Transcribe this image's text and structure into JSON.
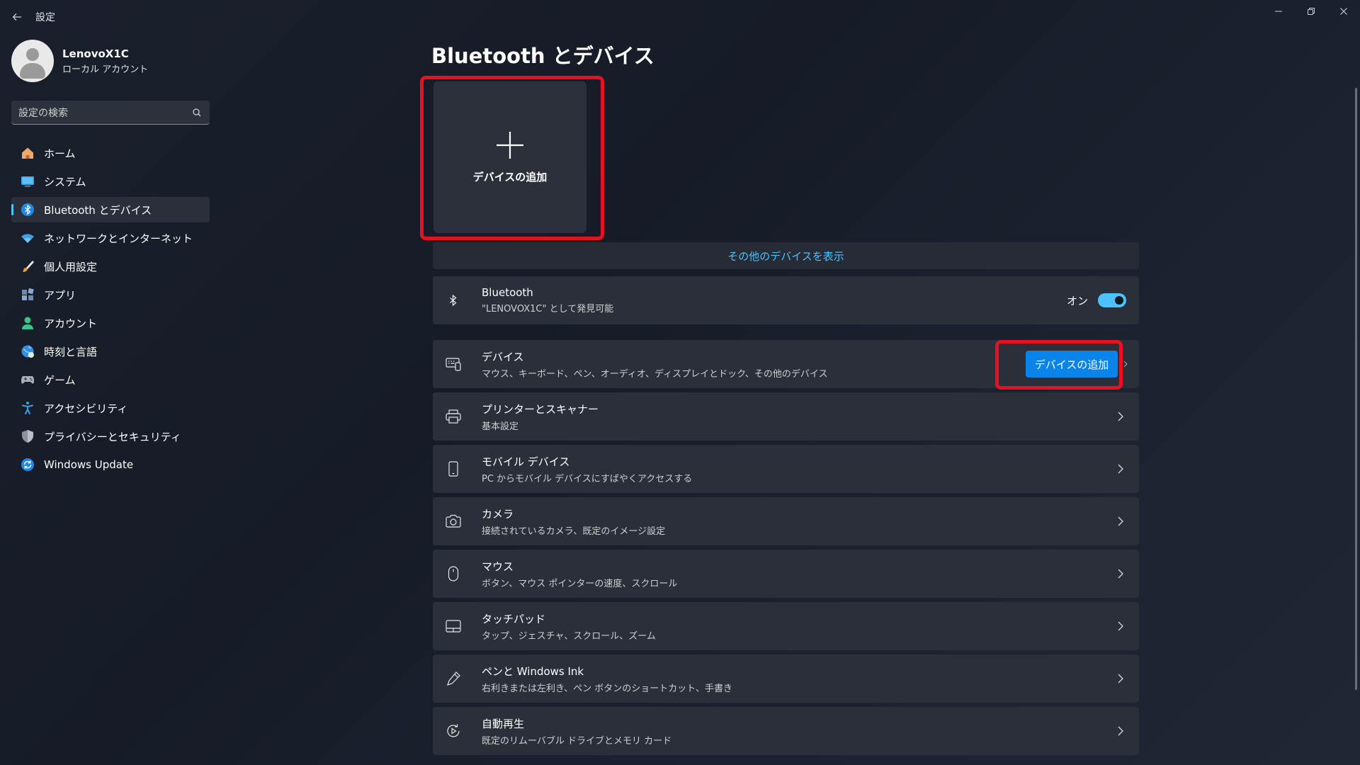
{
  "window": {
    "title": "設定"
  },
  "profile": {
    "name": "LenovoX1C",
    "account_type": "ローカル アカウント"
  },
  "search": {
    "placeholder": "設定の検索"
  },
  "sidebar": {
    "items": [
      {
        "label": "ホーム",
        "icon": "home-icon"
      },
      {
        "label": "システム",
        "icon": "system-icon"
      },
      {
        "label": "Bluetooth とデバイス",
        "icon": "bluetooth-icon",
        "active": true
      },
      {
        "label": "ネットワークとインターネット",
        "icon": "wifi-icon"
      },
      {
        "label": "個人用設定",
        "icon": "brush-icon"
      },
      {
        "label": "アプリ",
        "icon": "apps-icon"
      },
      {
        "label": "アカウント",
        "icon": "account-icon"
      },
      {
        "label": "時刻と言語",
        "icon": "globe-icon"
      },
      {
        "label": "ゲーム",
        "icon": "gamepad-icon"
      },
      {
        "label": "アクセシビリティ",
        "icon": "accessibility-icon"
      },
      {
        "label": "プライバシーとセキュリティ",
        "icon": "shield-icon"
      },
      {
        "label": "Windows Update",
        "icon": "update-icon"
      }
    ]
  },
  "main": {
    "title": "Bluetooth とデバイス",
    "add_tile_label": "デバイスの追加",
    "more_devices_link": "その他のデバイスを表示",
    "bluetooth": {
      "title": "Bluetooth",
      "subtitle": "\"LENOVOX1C\" として発見可能",
      "toggle_label": "オン",
      "toggle_on": true
    },
    "devices": {
      "title": "デバイス",
      "subtitle": "マウス、キーボード、ペン、オーディオ、ディスプレイとドック、その他のデバイス",
      "button_label": "デバイスの追加"
    },
    "cards": [
      {
        "title": "プリンターとスキャナー",
        "subtitle": "基本設定",
        "icon": "printer-icon"
      },
      {
        "title": "モバイル デバイス",
        "subtitle": "PC からモバイル デバイスにすばやくアクセスする",
        "icon": "phone-icon"
      },
      {
        "title": "カメラ",
        "subtitle": "接続されているカメラ、既定のイメージ設定",
        "icon": "camera-icon"
      },
      {
        "title": "マウス",
        "subtitle": "ボタン、マウス ポインターの速度、スクロール",
        "icon": "mouse-icon"
      },
      {
        "title": "タッチパッド",
        "subtitle": "タップ、ジェスチャ、スクロール、ズーム",
        "icon": "touchpad-icon"
      },
      {
        "title": "ペンと Windows Ink",
        "subtitle": "右利きまたは左利き、ペン ボタンのショートカット、手書き",
        "icon": "pen-icon"
      },
      {
        "title": "自動再生",
        "subtitle": "既定のリムーバブル ドライブとメモリ カード",
        "icon": "autoplay-icon"
      }
    ]
  },
  "colors": {
    "accent": "#4cc2ff",
    "button": "#0a84e8",
    "highlight": "#e81123",
    "card": "#2a2f39"
  }
}
